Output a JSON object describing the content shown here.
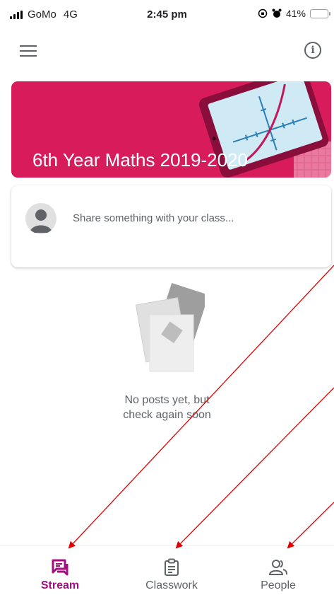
{
  "status_bar": {
    "carrier": "GoMo",
    "network": "4G",
    "time": "2:45 pm",
    "battery": "41%",
    "battery_level": 0.41
  },
  "app_bar": {
    "menu_icon": "hamburger-menu-icon",
    "info_icon": "info-icon"
  },
  "banner": {
    "title": "6th Year Maths 2019-2020",
    "color": "#d81b5b"
  },
  "share": {
    "placeholder": "Share something with your class..."
  },
  "empty_state": {
    "line1": "No posts yet, but",
    "line2": "check again soon"
  },
  "bottom_nav": {
    "accent_color": "#a50e7e",
    "items": [
      {
        "label": "Stream",
        "icon": "stream-icon",
        "active": true
      },
      {
        "label": "Classwork",
        "icon": "classwork-icon",
        "active": false
      },
      {
        "label": "People",
        "icon": "people-icon",
        "active": false
      }
    ]
  },
  "annotation_color": "#e00000"
}
